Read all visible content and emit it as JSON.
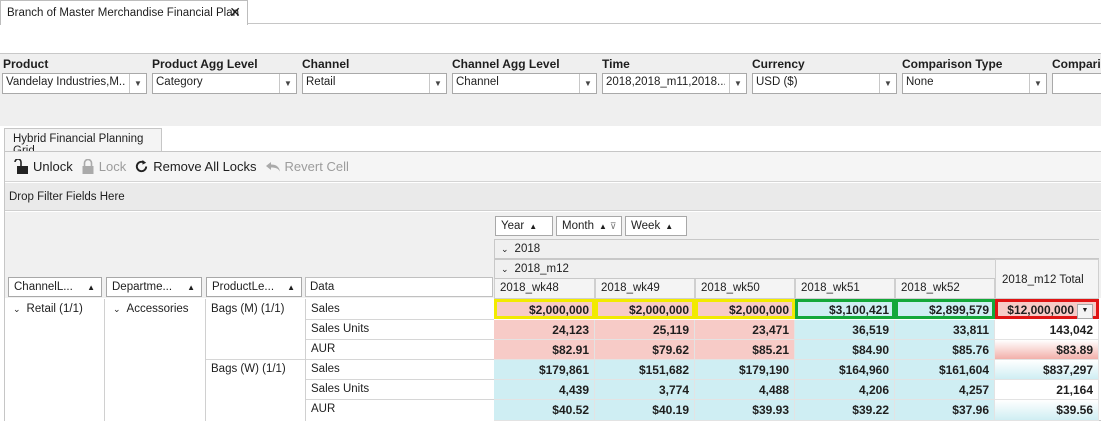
{
  "doc_tab": {
    "title": "Branch of Master Merchandise Financial Plan",
    "close": "✕"
  },
  "filters": [
    {
      "label": "Product",
      "value": "Vandelay Industries,M..."
    },
    {
      "label": "Product Agg Level",
      "value": "Category"
    },
    {
      "label": "Channel",
      "value": "Retail"
    },
    {
      "label": "Channel Agg Level",
      "value": "Channel"
    },
    {
      "label": "Time",
      "value": "2018,2018_m11,2018..."
    },
    {
      "label": "Currency",
      "value": "USD ($)"
    },
    {
      "label": "Comparison Type",
      "value": "None"
    },
    {
      "label": "Comparis",
      "value": ""
    }
  ],
  "grid_tab": "Hybrid Financial Planning Grid",
  "lockbar": {
    "unlock": "Unlock",
    "lock": "Lock",
    "remove_all": "Remove All Locks",
    "revert": "Revert Cell"
  },
  "drop_zone": "Drop Filter Fields Here",
  "column_fields": [
    "Year",
    "Month",
    "Week"
  ],
  "row_fields": [
    "ChannelL...",
    "Departme...",
    "ProductLe..."
  ],
  "data_header": "Data",
  "year": "2018",
  "month": "2018_m12",
  "weeks": [
    "2018_wk48",
    "2018_wk49",
    "2018_wk50",
    "2018_wk51",
    "2018_wk52"
  ],
  "total_header": "2018_m12 Total",
  "row_labels": {
    "channel": "Retail (1/1)",
    "department": "Accessories",
    "product_1": "Bags (M) (1/1)",
    "product_2": "Bags (W) (1/1)"
  },
  "measures": [
    "Sales",
    "Sales Units",
    "AUR",
    "Sales",
    "Sales Units",
    "AUR"
  ],
  "rows": [
    [
      "$2,000,000",
      "$2,000,000",
      "$2,000,000",
      "$3,100,421",
      "$2,899,579",
      "$12,000,000"
    ],
    [
      "24,123",
      "25,119",
      "23,471",
      "36,519",
      "33,811",
      "143,042"
    ],
    [
      "$82.91",
      "$79.62",
      "$85.21",
      "$84.90",
      "$85.76",
      "$83.89"
    ],
    [
      "$179,861",
      "$151,682",
      "$179,190",
      "$164,960",
      "$161,604",
      "$837,297"
    ],
    [
      "4,439",
      "3,774",
      "4,488",
      "4,206",
      "4,257",
      "21,164"
    ],
    [
      "$40.52",
      "$40.19",
      "$39.93",
      "$39.22",
      "$37.96",
      "$39.56"
    ]
  ],
  "icons": {
    "dropdown": "chevron-down-icon",
    "sort": "sort-up-icon",
    "expand": "collapse-chevron-icon"
  },
  "colors": {
    "pink": "#f7cbc7",
    "cyan": "#cfeef3",
    "highlight_yellow": "#f2ea00",
    "highlight_green": "#14a83a",
    "highlight_red": "#e01414"
  }
}
